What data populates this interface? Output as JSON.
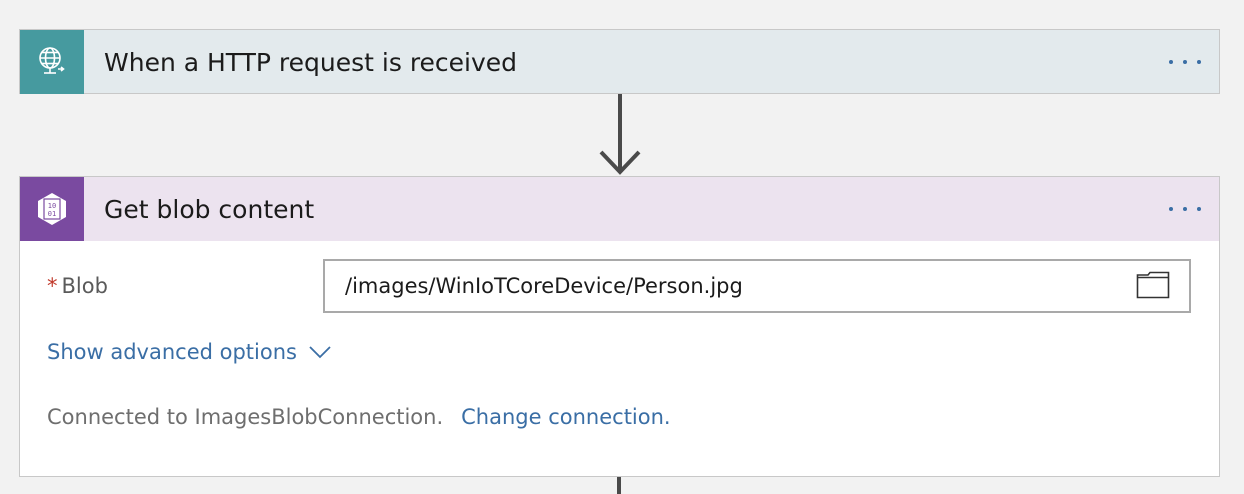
{
  "trigger": {
    "title": "When a HTTP request is received",
    "icon": "http-globe-icon",
    "accent": "#469a9f",
    "header_bg": "#e3eaed"
  },
  "action": {
    "title": "Get blob content",
    "icon": "blob-binary-icon",
    "accent": "#7a4aa0",
    "header_bg": "#ece3ef",
    "field": {
      "required_mark": "*",
      "label": "Blob",
      "value": "/images/WinIoTCoreDevice/Person.jpg"
    },
    "advanced_label": "Show advanced options",
    "connection_text": "Connected to ImagesBlobConnection.",
    "change_connection_label": "Change connection."
  },
  "icons": {
    "more": "ellipsis-icon",
    "folder": "folder-icon",
    "chevron": "chevron-down-icon",
    "arrow": "arrow-down-icon"
  }
}
